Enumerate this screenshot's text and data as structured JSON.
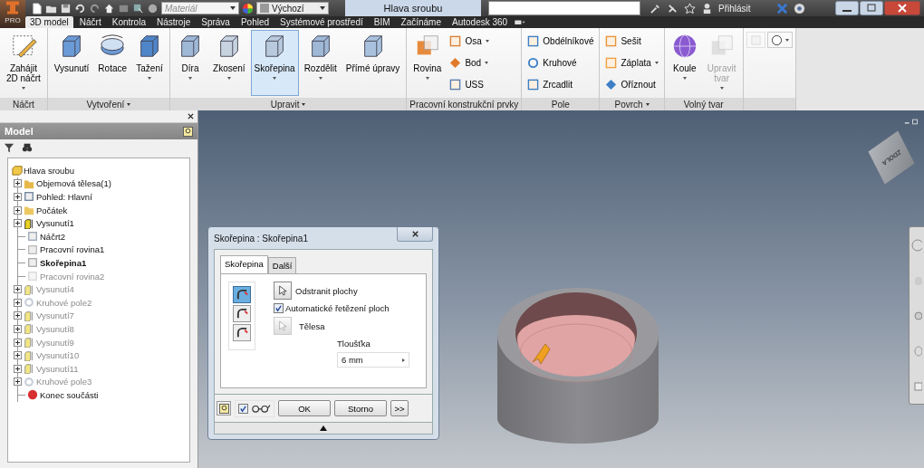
{
  "app_button": {
    "edition": "PRO"
  },
  "quick_access": {
    "material": {
      "placeholder": "Materiál"
    },
    "appearance": {
      "value": "Výchozí"
    }
  },
  "window": {
    "title": "Hlava sroubu"
  },
  "sign_in": {
    "label": "Přihlásit"
  },
  "tabs": [
    {
      "label": "3D model",
      "selected": true
    },
    {
      "label": "Náčrt",
      "selected": false
    },
    {
      "label": "Kontrola",
      "selected": false
    },
    {
      "label": "Nástroje",
      "selected": false
    },
    {
      "label": "Správa",
      "selected": false
    },
    {
      "label": "Pohled",
      "selected": false
    },
    {
      "label": "Systémové prostředí",
      "selected": false
    },
    {
      "label": "BIM",
      "selected": false
    },
    {
      "label": "Začínáme",
      "selected": false
    },
    {
      "label": "Autodesk 360",
      "selected": false
    }
  ],
  "ribbon": [
    {
      "label": "Náčrt",
      "menu": false,
      "tools": [
        {
          "kind": "large",
          "label": "Zahájit\n2D náčrt",
          "dropdown": true,
          "selected": false,
          "disabled": false
        }
      ]
    },
    {
      "label": "Vytvoření",
      "menu": true,
      "tools": [
        {
          "kind": "large",
          "label": "Vysunutí",
          "dropdown": false,
          "selected": false,
          "disabled": false
        },
        {
          "kind": "large",
          "label": "Rotace",
          "dropdown": false,
          "selected": false,
          "disabled": false
        },
        {
          "kind": "large",
          "label": "Tažení",
          "dropdown": true,
          "selected": false,
          "disabled": false
        }
      ]
    },
    {
      "label": "Upravit",
      "menu": true,
      "tools": [
        {
          "kind": "large",
          "label": "Díra",
          "dropdown": true,
          "selected": false,
          "disabled": false
        },
        {
          "kind": "large",
          "label": "Zkosení",
          "dropdown": true,
          "selected": false,
          "disabled": false
        },
        {
          "kind": "large",
          "label": "Skořepina",
          "dropdown": true,
          "selected": true,
          "disabled": false
        },
        {
          "kind": "large",
          "label": "Rozdělit",
          "dropdown": true,
          "selected": false,
          "disabled": false
        },
        {
          "kind": "large",
          "label": "Přímé úpravy",
          "dropdown": false,
          "selected": false,
          "disabled": false
        }
      ]
    },
    {
      "label": "Pracovní konstrukční prvky",
      "menu": false,
      "tools": [
        {
          "kind": "large",
          "label": "Rovina",
          "dropdown": true,
          "selected": false,
          "disabled": false
        },
        {
          "kind": "stack",
          "items": [
            {
              "label": "Osa",
              "dropdown": true
            },
            {
              "label": "Bod",
              "dropdown": true
            },
            {
              "label": "USS",
              "dropdown": false
            }
          ]
        }
      ]
    },
    {
      "label": "Pole",
      "menu": false,
      "tools": [
        {
          "kind": "stack",
          "items": [
            {
              "label": "Obdélníkové",
              "dropdown": false
            },
            {
              "label": "Kruhové",
              "dropdown": false
            },
            {
              "label": "Zrcadlit",
              "dropdown": false
            }
          ]
        }
      ]
    },
    {
      "label": "Povrch",
      "menu": true,
      "tools": [
        {
          "kind": "stack",
          "items": [
            {
              "label": "Sešit",
              "dropdown": false
            },
            {
              "label": "Záplata",
              "dropdown": true
            },
            {
              "label": "Oříznout",
              "dropdown": false
            }
          ]
        }
      ]
    },
    {
      "label": "Volný tvar",
      "menu": false,
      "tools": [
        {
          "kind": "large",
          "label": "Koule",
          "dropdown": true,
          "selected": false,
          "disabled": false
        },
        {
          "kind": "large",
          "label": "Upravit\ntvar",
          "dropdown": true,
          "selected": false,
          "disabled": true
        }
      ]
    },
    {
      "tools": [
        {
          "kind": "icon",
          "dropdown": false,
          "disabled": true
        },
        {
          "kind": "icon",
          "dropdown": true,
          "disabled": false
        }
      ]
    }
  ],
  "browser": {
    "title": "Model",
    "tree": {
      "label": "Hlava sroubu",
      "children": [
        {
          "kind": "bodies",
          "label": "Objemová tělesa(1)",
          "expandable": true,
          "bold": false,
          "dimmed": false
        },
        {
          "kind": "view",
          "label": "Pohled: Hlavní",
          "expandable": true,
          "bold": false,
          "dimmed": false
        },
        {
          "kind": "folder",
          "label": "Počátek",
          "expandable": true,
          "bold": false,
          "dimmed": false
        },
        {
          "kind": "extrude",
          "label": "Vysunutí1",
          "expandable": true,
          "bold": false,
          "dimmed": false
        },
        {
          "kind": "sketch",
          "label": "Náčrt2",
          "expandable": false,
          "bold": false,
          "dimmed": false
        },
        {
          "kind": "plane",
          "label": "Pracovní rovina1",
          "expandable": false,
          "bold": false,
          "dimmed": false
        },
        {
          "kind": "shell",
          "label": "Skořepina1",
          "expandable": false,
          "bold": true,
          "dimmed": false
        },
        {
          "kind": "plane",
          "label": "Pracovní rovina2",
          "expandable": false,
          "bold": false,
          "dimmed": true
        },
        {
          "kind": "extrude",
          "label": "Vysunutí4",
          "expandable": true,
          "bold": false,
          "dimmed": true
        },
        {
          "kind": "pattern",
          "label": "Kruhové pole2",
          "expandable": true,
          "bold": false,
          "dimmed": true
        },
        {
          "kind": "extrude",
          "label": "Vysunutí7",
          "expandable": true,
          "bold": false,
          "dimmed": true
        },
        {
          "kind": "extrude",
          "label": "Vysunutí8",
          "expandable": true,
          "bold": false,
          "dimmed": true
        },
        {
          "kind": "extrude",
          "label": "Vysunutí9",
          "expandable": true,
          "bold": false,
          "dimmed": true
        },
        {
          "kind": "extrude",
          "label": "Vysunutí10",
          "expandable": true,
          "bold": false,
          "dimmed": true
        },
        {
          "kind": "extrude",
          "label": "Vysunutí11",
          "expandable": true,
          "bold": false,
          "dimmed": true
        },
        {
          "kind": "pattern",
          "label": "Kruhové pole3",
          "expandable": true,
          "bold": false,
          "dimmed": true
        },
        {
          "kind": "end",
          "label": "Konec součásti",
          "expandable": false,
          "bold": false,
          "dimmed": false
        }
      ]
    }
  },
  "viewcube": {
    "face": "ZDOLA"
  },
  "dialog": {
    "title": "Skořepina : Skořepina1",
    "tabs": [
      {
        "label": "Skořepina",
        "selected": true
      },
      {
        "label": "Další",
        "selected": false
      }
    ],
    "modes": [
      {
        "selected": true
      },
      {
        "selected": false
      },
      {
        "selected": false
      }
    ],
    "remove_faces": {
      "label": "Odstranit plochy",
      "disabled": false
    },
    "auto_chain": {
      "label": "Automatické řetězení ploch",
      "checked": true
    },
    "bodies": {
      "label": "Tělesa",
      "disabled": true
    },
    "thickness": {
      "label": "Tloušťka",
      "value": "6 mm"
    },
    "preview": {
      "checked": true
    },
    "buttons": [
      {
        "label": "OK"
      },
      {
        "label": "Storno"
      },
      {
        "label": ">>"
      }
    ]
  }
}
